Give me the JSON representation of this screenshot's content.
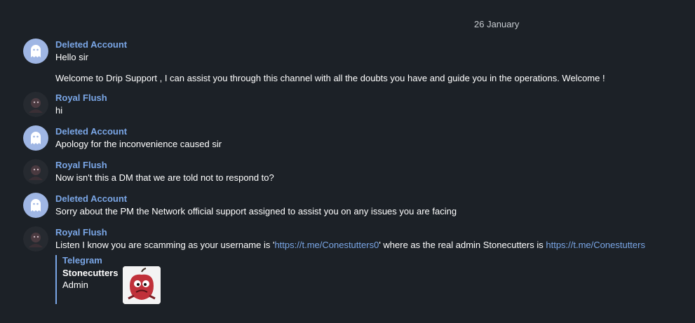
{
  "date_separator": "26 January",
  "messages": [
    {
      "sender": "Deleted Account",
      "lines": [
        "Hello sir",
        "Welcome to Drip Support , I can assist you through this channel with all the doubts you have and guide you in the operations. Welcome !"
      ]
    },
    {
      "sender": "Royal Flush",
      "lines": [
        "hi"
      ]
    },
    {
      "sender": "Deleted Account",
      "lines": [
        "Apology for the inconvenience caused sir"
      ]
    },
    {
      "sender": "Royal Flush",
      "lines": [
        "Now isn't this a DM that we are told not to respond to?"
      ]
    },
    {
      "sender": "Deleted Account",
      "lines": [
        "Sorry about the PM the Network official support assigned to assist you on any issues you are facing"
      ]
    },
    {
      "sender": "Royal Flush",
      "text_parts": {
        "a": "Listen I know you are scamming as your username is '",
        "link1": "https://t.me/Conestutters0",
        "b": "' where as the real admin Stonecutters is ",
        "link2": "https://t.me/Conestutters"
      }
    }
  ],
  "link_preview": {
    "site": "Telegram",
    "title": "Stonecutters",
    "description": "Admin"
  },
  "colors": {
    "background": "#1c2127",
    "accent": "#7aa6e6",
    "ghost_avatar": "#9fb6e4"
  }
}
